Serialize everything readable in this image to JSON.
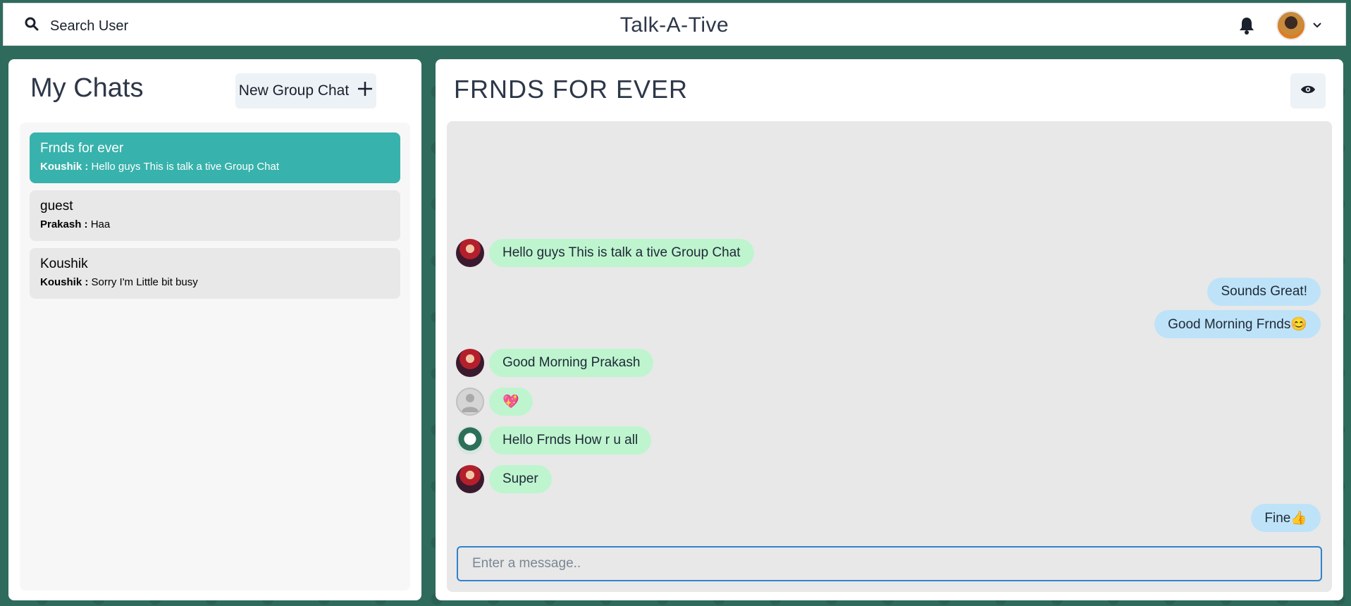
{
  "header": {
    "search_label": "Search User",
    "app_title": "Talk-A-Tive",
    "search_icon": "search-icon",
    "notification_icon": "bell-icon",
    "profile_menu_icon": "chevron-down-icon"
  },
  "left_panel": {
    "title": "My Chats",
    "new_group_label": "New Group Chat",
    "chats": [
      {
        "name": "Frnds for ever",
        "sender": "Koushik :",
        "message": "Hello guys This is talk a tive Group Chat",
        "active": true
      },
      {
        "name": "guest",
        "sender": "Prakash :",
        "message": "Haa",
        "active": false
      },
      {
        "name": "Koushik",
        "sender": "Koushik :",
        "message": "Sorry I'm Little bit busy",
        "active": false
      }
    ]
  },
  "right_panel": {
    "chat_title": "FRNDS FOR EVER",
    "view_icon": "eye-icon",
    "messages": [
      {
        "text": "Hello guys This is talk a tive Group Chat",
        "direction": "in"
      },
      {
        "text": "Sounds Great!",
        "direction": "out"
      },
      {
        "text": "Good Morning Frnds😊",
        "direction": "out"
      },
      {
        "text": "Good Morning Prakash",
        "direction": "in"
      },
      {
        "text": "💖",
        "direction": "in"
      },
      {
        "text": "Hello Frnds How r u all",
        "direction": "in"
      },
      {
        "text": "Super",
        "direction": "in"
      },
      {
        "text": "Fine👍",
        "direction": "out"
      }
    ],
    "input_placeholder": "Enter a message.."
  },
  "colors": {
    "active_chat": "#38b2ac",
    "incoming_bubble": "#bef5cf",
    "outgoing_bubble": "#bee3f8",
    "input_border": "#3182ce"
  }
}
